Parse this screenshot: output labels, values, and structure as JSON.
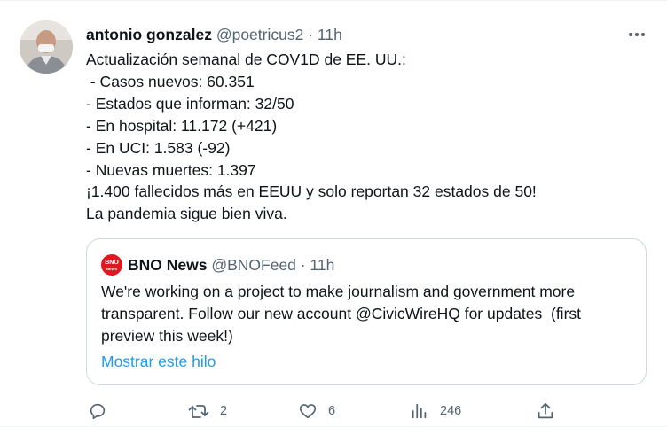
{
  "tweet": {
    "author_name": "antonio gonzalez",
    "handle": "@poetricus2",
    "separator": "·",
    "time": "11h",
    "lines": [
      "Actualización semanal de COV1D de EE. UU.:",
      " - Casos nuevos: 60.351",
      "- Estados que informan: 32/50",
      "- En hospital: 11.172 (+421)",
      "- En UCI: 1.583 (-92)",
      "- Nuevas muertes: 1.397",
      "¡1.400 fallecidos más en EEUU y solo reportan 32 estados de 50!",
      "La pandemia sigue bien viva."
    ]
  },
  "quote": {
    "avatar_line1": "BNO",
    "avatar_line2": "NEWS",
    "author_name": "BNO News",
    "handle": "@BNOFeed",
    "separator": "·",
    "time": "11h",
    "lines": [
      "We're working on a project to make journalism and government more",
      "transparent. Follow our new account @CivicWireHQ for updates  (first",
      "preview this week!)"
    ],
    "show_thread": "Mostrar este hilo"
  },
  "actions": {
    "reply_count": "",
    "retweet_count": "2",
    "like_count": "6",
    "views_count": "246"
  },
  "icons": {
    "more": "more-horizontal-icon",
    "reply": "reply-icon",
    "retweet": "retweet-icon",
    "like": "heart-icon",
    "views": "views-chart-icon",
    "share": "share-icon"
  },
  "colors": {
    "text": "#0f1419",
    "muted": "#536471",
    "link": "#1d9bf0",
    "border": "#cfd9de",
    "bno_red": "#e0181f"
  }
}
